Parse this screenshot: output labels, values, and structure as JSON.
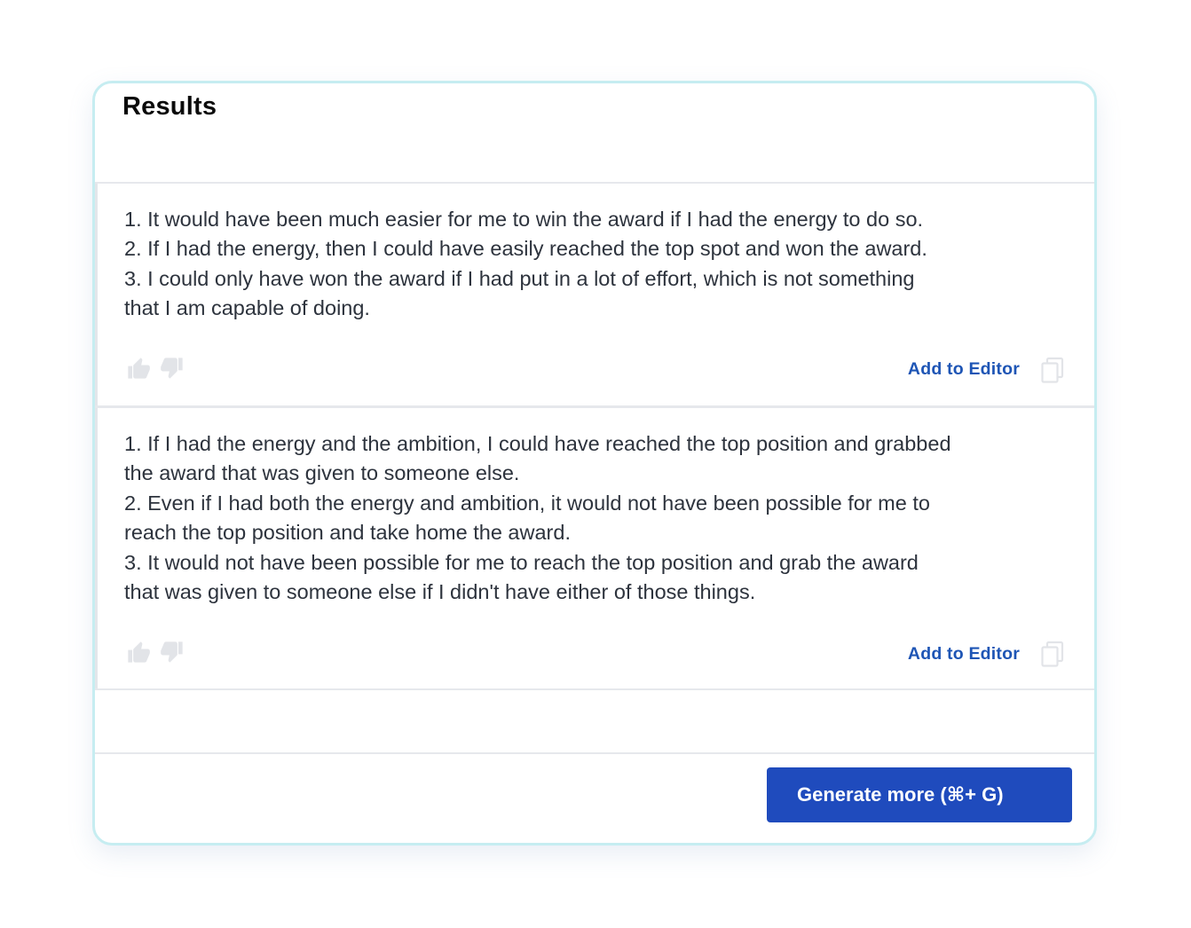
{
  "panel": {
    "title": "Results"
  },
  "results": [
    {
      "lines": [
        "1. It would have been much easier for me to win the award if I had the energy to do so.",
        "2. If I had the energy, then I could have easily reached the top spot and won the award.",
        "3. I could only have won the award if I had put in a lot of effort, which is not something",
        "that I am capable of doing."
      ],
      "add_to_editor_label": "Add to Editor",
      "like_icon": "thumbs-up-icon",
      "dislike_icon": "thumbs-down-icon",
      "copy_icon": "copy-icon"
    },
    {
      "lines": [
        "1. If I had the energy and the ambition, I could have reached the top position and grabbed",
        "the award that was given to someone else.",
        "2. Even if I had both the energy and ambition, it would not have been possible for me to",
        "reach the top position and take home the award.",
        "3. It would not have been possible for me to reach the top position and grab the award",
        "that was given to someone else if I didn't have either of those things."
      ],
      "add_to_editor_label": "Add to Editor",
      "like_icon": "thumbs-up-icon",
      "dislike_icon": "thumbs-down-icon",
      "copy_icon": "copy-icon"
    }
  ],
  "footer": {
    "generate_more_label": "Generate more (⌘+ G)"
  },
  "colors": {
    "card_border": "#c6edf1",
    "link": "#1e55b5",
    "button": "#1f4bbd",
    "body_text": "#2d333d",
    "muted_icon": "#e2e4e8"
  }
}
